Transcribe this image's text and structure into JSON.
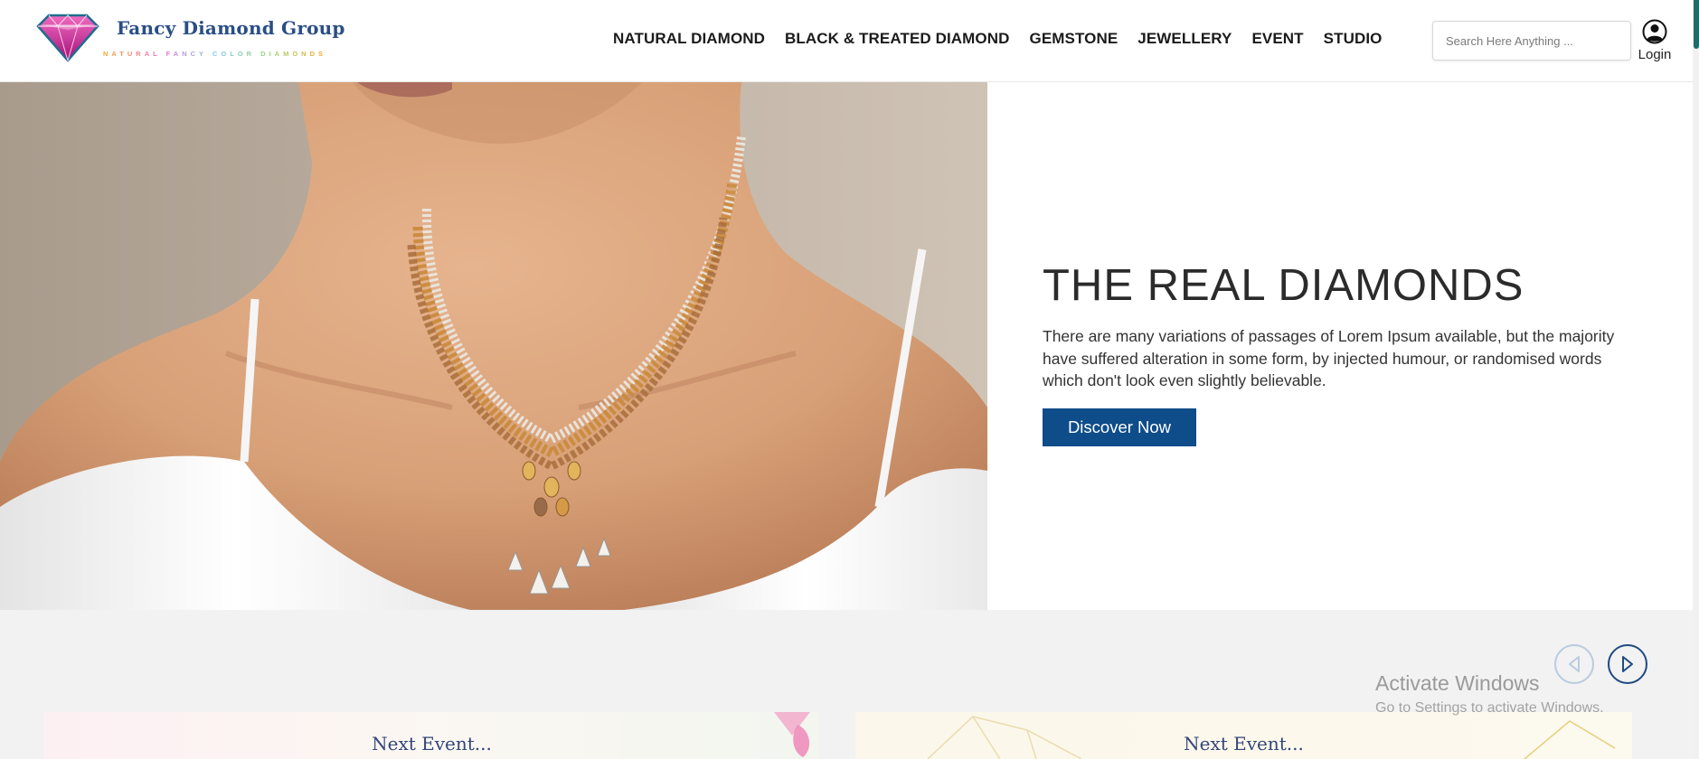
{
  "brand": {
    "name": "Fancy Diamond Group",
    "tagline": "NATURAL FANCY COLOR DIAMONDS"
  },
  "nav": {
    "items": [
      {
        "label": "NATURAL DIAMOND"
      },
      {
        "label": "BLACK & TREATED DIAMOND"
      },
      {
        "label": "GEMSTONE"
      },
      {
        "label": "JEWELLERY"
      },
      {
        "label": "EVENT"
      },
      {
        "label": "STUDIO"
      }
    ]
  },
  "search": {
    "placeholder": "Search Here Anything ...",
    "value": ""
  },
  "account": {
    "login_label": "Login",
    "icon": "user-circle-icon"
  },
  "hero": {
    "title": "THE REAL DIAMONDS",
    "description": "There are many variations of passages of Lorem Ipsum available, but the majority have suffered alteration in some form, by injected humour, or randomised words which don't look even slightly believable.",
    "cta_label": "Discover Now",
    "image": "woman-wearing-diamond-necklace"
  },
  "events": {
    "prev_icon": "chevron-left-circle-icon",
    "next_icon": "chevron-right-circle-icon",
    "cards": [
      {
        "title": "Next Event..."
      },
      {
        "title": "Next Event..."
      }
    ]
  },
  "os_watermark": {
    "title": "Activate Windows",
    "subtitle": "Go to Settings to activate Windows."
  },
  "colors": {
    "primary": "#0f4c8a",
    "brand_text": "#2a4e86",
    "band_bg": "#f2f2f2",
    "card_title": "#34467a"
  }
}
